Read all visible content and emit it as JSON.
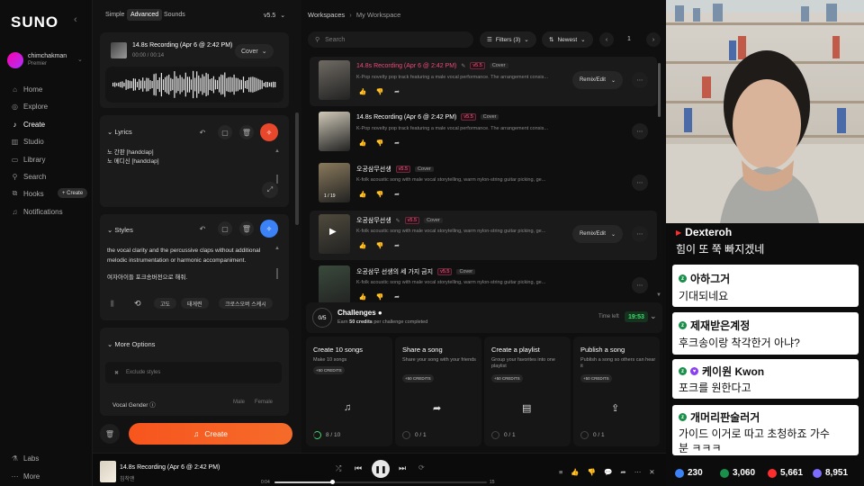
{
  "nav": {
    "logo": "SUNO",
    "collapse_icon": "chevron-left-icon",
    "user": {
      "name": "chimchakman",
      "plan": "Premier"
    },
    "items": [
      {
        "label": "Home",
        "icon": "home-icon"
      },
      {
        "label": "Explore",
        "icon": "compass-icon"
      },
      {
        "label": "Create",
        "icon": "music-note-icon"
      },
      {
        "label": "Studio",
        "icon": "studio-icon"
      },
      {
        "label": "Library",
        "icon": "library-icon"
      },
      {
        "label": "Search",
        "icon": "search-icon"
      },
      {
        "label": "Hooks",
        "icon": "hooks-icon"
      },
      {
        "label": "Notifications",
        "icon": "bell-icon"
      }
    ],
    "hooks_chip": "+ Create",
    "footer": [
      {
        "label": "Labs"
      },
      {
        "label": "More"
      }
    ]
  },
  "create": {
    "modes": [
      "Simple",
      "Advanced",
      "Sounds"
    ],
    "selected_mode": "Advanced",
    "version": "v5.5",
    "recording": {
      "title": "14.8s Recording (Apr 6 @ 2:42 PM)",
      "time": "00:00 / 00:14",
      "cover_label": "Cover"
    },
    "lyrics": {
      "title": "Lyrics",
      "lines": [
        "노 간판 [handclap]",
        "노 메디신 [handclap]"
      ]
    },
    "styles": {
      "title": "Styles",
      "text": "the vocal clarity and the percussive claps without additional melodic instrumentation or harmonic accompaniment.",
      "text2": "여자아이들 포크송버전으로 해줘.",
      "tags": [
        "고도",
        "태게련",
        "크로스오버 스케시"
      ]
    },
    "more_options": {
      "title": "More Options",
      "exclude_placeholder": "Exclude styles",
      "vocal_gender": "Vocal Gender",
      "male": "Male",
      "female": "Female"
    },
    "create_label": "Create"
  },
  "workspace": {
    "breadcrumb": [
      "Workspaces",
      "My Workspace"
    ],
    "search_placeholder": "Search",
    "filters_label": "Filters (3)",
    "sort_label": "Newest",
    "page": "1",
    "songs": [
      {
        "title": "14.8s Recording (Apr 6 @ 2:42 PM)",
        "version": "v5.5",
        "tag": "Cover",
        "desc": "K-Pop novelty pop track featuring a male vocal performance. The arrangement consis...",
        "pink": true,
        "remix": "Remix/Edit",
        "thumb": "#6f6a63"
      },
      {
        "title": "14.8s Recording (Apr 6 @ 2:42 PM)",
        "version": "v5.5",
        "tag": "Cover",
        "desc": "K-Pop novelty pop track featuring a male vocal performance. The arrangement consis...",
        "pink": false,
        "remix": "",
        "thumb": "#cfc9b8"
      },
      {
        "title": "오공삼무선생",
        "version": "v5.5",
        "tag": "Cover",
        "desc": "K-folk acoustic song with male vocal storytelling, warm nylon-string guitar picking, ge...",
        "pink": false,
        "remix": "",
        "thumb": "#8a7a5c"
      },
      {
        "title": "오공삼무선생",
        "version": "v5.5",
        "tag": "Cover",
        "desc": "K-folk acoustic song with male vocal storytelling, warm nylon-string guitar picking, ge...",
        "pink": false,
        "remix": "Remix/Edit",
        "thumb": "#4f4a3c"
      },
      {
        "title": "오공삼무 선생의 세 가지 금지",
        "version": "v5.5",
        "tag": "Cover",
        "desc": "K-folk acoustic song with male vocal storytelling, warm nylon-string guitar picking, ge...",
        "pink": false,
        "remix": "",
        "thumb": "#3a4a3c"
      }
    ],
    "thumb_labels": [
      "",
      "",
      "1 / 19",
      "",
      ""
    ],
    "challenges": {
      "count": "0/5",
      "title": "Challenges",
      "sub_pre": "Earn ",
      "sub_bold": "50 credits",
      "sub_post": " per challenge completed",
      "time_left_label": "Time left",
      "time_left": "19:53",
      "cards": [
        {
          "title": "Create 10 songs",
          "desc": "Make 10 songs",
          "credits": "+50 CREDITS",
          "progress": "8 / 10",
          "icon": "music-note-icon",
          "glyph": "♫"
        },
        {
          "title": "Share a song",
          "desc": "Share your song with your friends",
          "credits": "+50 CREDITS",
          "progress": "0 / 1",
          "icon": "share-icon",
          "glyph": "➦"
        },
        {
          "title": "Create a playlist",
          "desc": "Group your favorites into one playlist",
          "credits": "+50 CREDITS",
          "progress": "0 / 1",
          "icon": "playlist-icon",
          "glyph": "▤"
        },
        {
          "title": "Publish a song",
          "desc": "Publish a song so others can hear it",
          "credits": "+50 CREDITS",
          "progress": "0 / 1",
          "icon": "upload-icon",
          "glyph": "⇪"
        }
      ]
    }
  },
  "player": {
    "title": "14.8s Recording (Apr 6 @ 2:42 PM)",
    "artist": "침착맨",
    "elapsed": "0:04",
    "duration": "15",
    "progress": 0.27
  },
  "chat": {
    "messages": [
      {
        "name": "Dexteroh",
        "text": "힘이 또 쭉 빠지겠네"
      },
      {
        "name": "아하그거",
        "text": "기대되네요"
      },
      {
        "name": "제재받은계정",
        "text": "후크송이랑 착각한거 아냐?"
      },
      {
        "name": "케이원 Kwon",
        "text": "포크를 원한다고"
      },
      {
        "name": "개머리판술러거",
        "text": "가이드 이거로 따고 초청하죠 가수"
      },
      {
        "name": "",
        "text": "분 ㅋㅋㅋ"
      }
    ],
    "stats": [
      {
        "value": "230",
        "color": "#3b82f6"
      },
      {
        "value": "3,060",
        "color": "#1a8f4a"
      },
      {
        "value": "5,661",
        "color": "#ff2d2d"
      },
      {
        "value": "8,951",
        "color": "#7c6cff"
      }
    ]
  }
}
